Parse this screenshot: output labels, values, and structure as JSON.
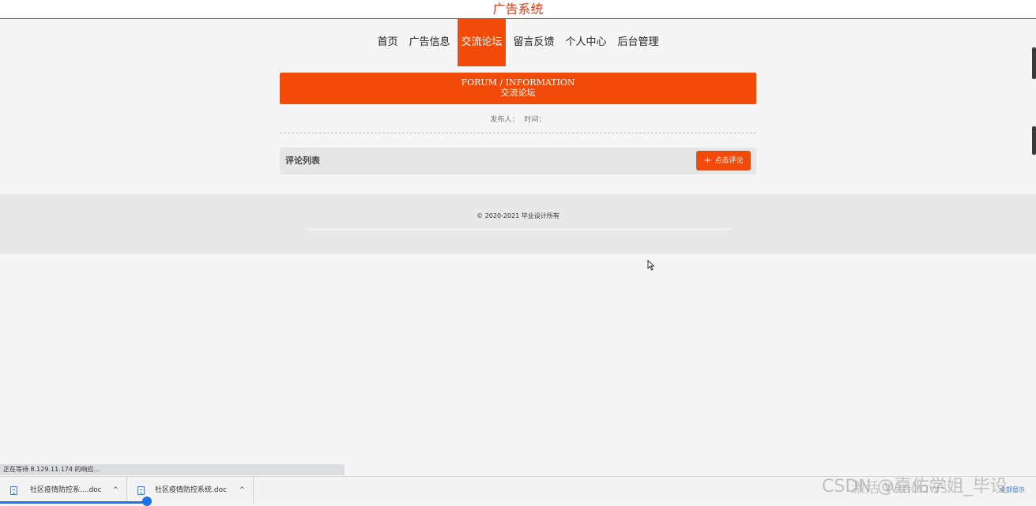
{
  "header": {
    "site_title": "广告系统"
  },
  "nav": {
    "items": [
      {
        "label": "首页",
        "active": false
      },
      {
        "label": "广告信息",
        "active": false
      },
      {
        "label": "交流论坛",
        "active": true
      },
      {
        "label": "留言反馈",
        "active": false
      },
      {
        "label": "个人中心",
        "active": false
      },
      {
        "label": "后台管理",
        "active": false
      }
    ]
  },
  "banner": {
    "english": "FORUM / INFORMATION",
    "chinese": "交流论坛"
  },
  "post_meta": {
    "publisher_label": "发布人：",
    "time_label": "时间："
  },
  "comments": {
    "title": "评论列表",
    "button_label": "点击评论"
  },
  "footer": {
    "copyright": "© 2020-2021 毕业设计所有"
  },
  "browser": {
    "status_text": "正在等待 8.129.11.174 的响应...",
    "downloads": [
      {
        "name": "社区疫情防控系....doc"
      },
      {
        "name": "社区疫情防控系统.doc"
      }
    ],
    "show_all_label": "全部显示"
  },
  "overlay": {
    "watermark": "CSDN @嘉佑学姐_毕设",
    "activate_windows": "激活 Windows"
  },
  "colors": {
    "accent": "#f24a08",
    "title_red": "#e43a1a"
  }
}
